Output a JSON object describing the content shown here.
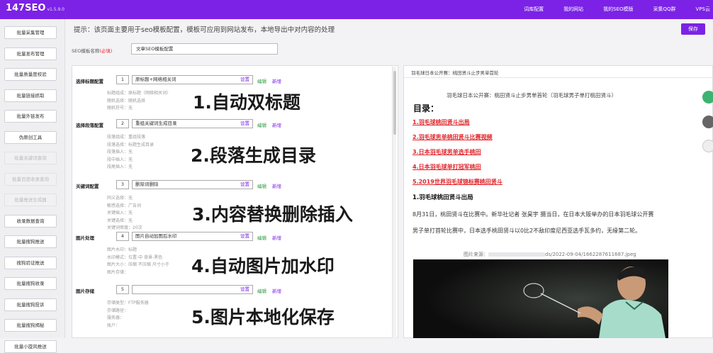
{
  "app": {
    "logo": "147SEO",
    "version": "v1.5.9.0"
  },
  "topnav": [
    "词库配置",
    "我的网站",
    "我的SEO模版",
    "采集QQ群",
    "VPS云"
  ],
  "sidebar": [
    {
      "label": "批量采集管理",
      "enabled": true
    },
    {
      "label": "批量发布管理",
      "enabled": true
    },
    {
      "label": "批量质量度校验",
      "enabled": true
    },
    {
      "label": "批量链接抓取",
      "enabled": true
    },
    {
      "label": "批量外链发布",
      "enabled": true
    },
    {
      "label": "伪原创工具",
      "enabled": true
    },
    {
      "label": "批量关键词查询",
      "enabled": false
    },
    {
      "label": "批量百度收录查询",
      "enabled": false
    },
    {
      "label": "批量推送生成器",
      "enabled": false
    },
    {
      "label": "收录数据查询",
      "enabled": true
    },
    {
      "label": "批量搜狗推送",
      "enabled": true
    },
    {
      "label": "搜狗验证推送",
      "enabled": true
    },
    {
      "label": "批量搜狗收录",
      "enabled": true
    },
    {
      "label": "批量搜狗投诉",
      "enabled": true
    },
    {
      "label": "批量搜狗揭秘",
      "enabled": true
    },
    {
      "label": "批量小旋风推送",
      "enabled": true
    }
  ],
  "hint": "提示：该页面主要用于seo模板配置，模板可应用到网站发布，本地导出中对内容的处理",
  "save_label": "保存",
  "template_name": {
    "label": "SEO模板名称",
    "required": "(必填)",
    "value": "文章SEO模板配置"
  },
  "config_rows": [
    {
      "label": "选择标题配置",
      "num": "1",
      "value": "原标题+网络相关词",
      "set": "设置",
      "edit": "编辑",
      "new": "新增",
      "details": [
        "标题组成：原标题（网络相关词）",
        "随机选择：随机选择",
        "随机符号：无"
      ]
    },
    {
      "label": "选择段落配置",
      "num": "2",
      "value": "重组关键词生成目录",
      "set": "设置",
      "edit": "编辑",
      "new": "新增",
      "details": [
        "段落组成：重组段落",
        "段落选择：标题生成目录",
        "段落插入：无",
        "段中插入：无",
        "段尾插入：无"
      ]
    },
    {
      "label": "关键词配置",
      "num": "3",
      "value": "删除词删除",
      "set": "设置",
      "edit": "编辑",
      "new": "新增",
      "details": [
        "同义选择：无",
        "敏感选择：广告词",
        "关键插入：无",
        "关键选择：无",
        "关键词密度：20次"
      ]
    },
    {
      "label": "图片处理",
      "num": "4",
      "value": "图片自动加图后水印",
      "set": "设置",
      "edit": "编辑",
      "new": "新增",
      "details": [
        "图片水印：标题",
        "水印模式：位置-中 背景-黑色",
        "图片大小：压缩 不压缩 尺寸小于",
        "图片存储："
      ]
    },
    {
      "label": "图片存储",
      "num": "5",
      "value": "",
      "set": "设置",
      "edit": "编辑",
      "new": "新增",
      "details": [
        "存储类型：FTP服务器",
        "存储路径：",
        "服务器：",
        "账户："
      ]
    }
  ],
  "overlays": [
    "1.自动双标题",
    "2.段落生成目录",
    "3.内容替换删除插入",
    "4.自动图片加水印",
    "5.图片本地化保存"
  ],
  "preview": {
    "title_bar": "羽毛球日本公开赛：桃田贤斗止步男单首轮",
    "article_title": "羽毛球日本公开赛：桃田贤斗止步男单首轮（羽毛球男子单打桃田贤斗）",
    "toc_heading": "目录：",
    "toc": [
      "1.羽毛球桃田贤斗出局",
      "2.羽毛球男单桃田贤斗比赛视频",
      "3.日本羽毛球男单选手桃田",
      "4.日本羽毛球单打冠军桃田",
      "5.2019世界羽毛球锦标赛桃田贤斗"
    ],
    "section_heading": "1.羽毛球桃田贤斗出局",
    "paragraph_lines": [
      "8月31日，桃田贤斗在比赛中。新华社记者 张昊宇 摄当日，在日本大阪举办的日本羽毛球公开赛",
      "男子单打首轮比赛中，日本选手桃田贤斗以0比2不敌印度尼西亚选手瓦多约，无缘第二轮。"
    ],
    "caption_prefix": "图片来源：",
    "caption_suffix": "ds/2022-09-04/1662287611687.jpeg"
  },
  "colors": {
    "accent": "#7b22e6",
    "link_red": "#e0242a",
    "edit_green": "#2a9d3a"
  }
}
